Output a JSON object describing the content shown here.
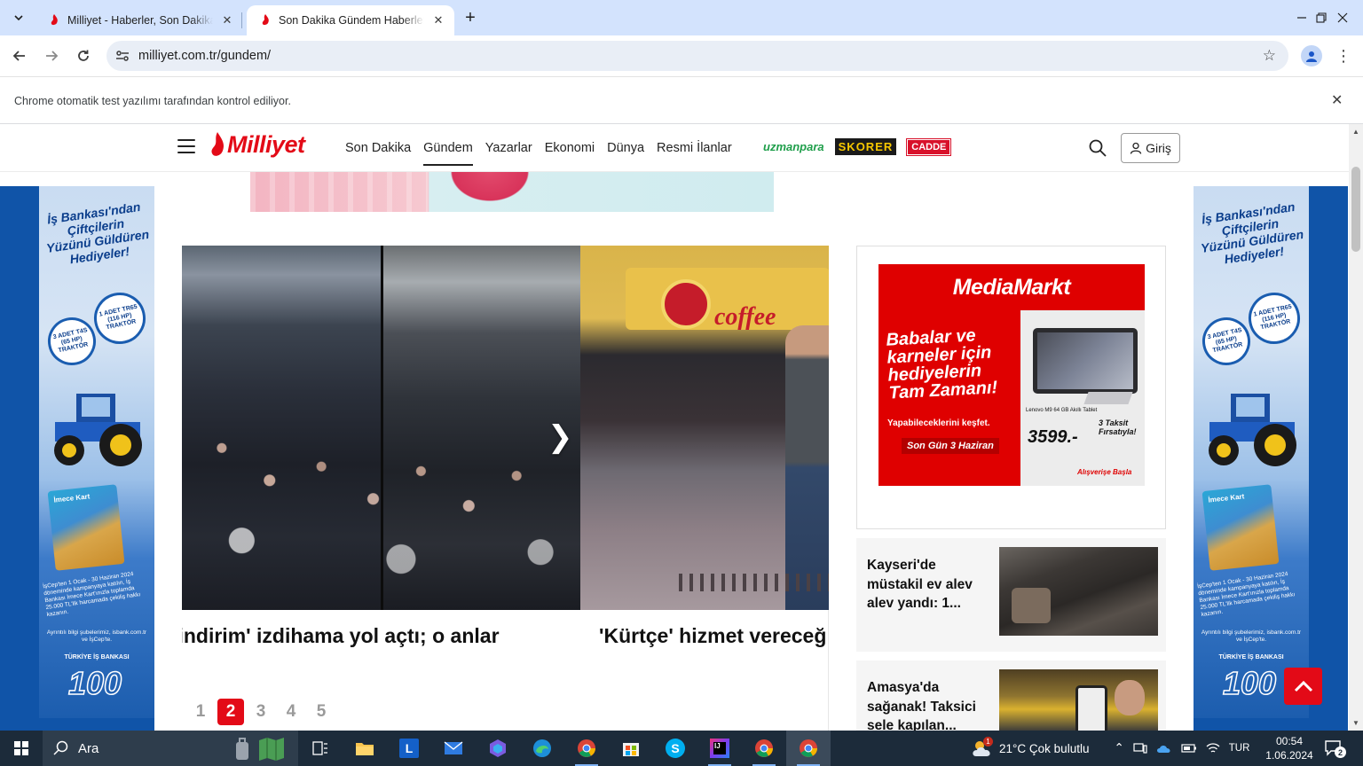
{
  "browser": {
    "tabs": [
      {
        "title": "Milliyet - Haberler, Son Dakika Haberleri",
        "active": false
      },
      {
        "title": "Son Dakika Gündem Haberleri",
        "active": true
      }
    ],
    "url": "milliyet.com.tr/gundem/",
    "infobar_message": "Chrome otomatik test yazılımı tarafından kontrol ediliyor."
  },
  "site": {
    "logo_text": "Milliyet",
    "nav": [
      {
        "label": "Son Dakika",
        "active": false
      },
      {
        "label": "Gündem",
        "active": true
      },
      {
        "label": "Yazarlar",
        "active": false
      },
      {
        "label": "Ekonomi",
        "active": false
      },
      {
        "label": "Dünya",
        "active": false
      },
      {
        "label": "Resmi İlanlar",
        "active": false
      }
    ],
    "brands": [
      "uzmanpara",
      "SKORER",
      "CADDE"
    ],
    "login_label": "Giriş"
  },
  "side_ad": {
    "title": "İş Bankası'ndan Çiftçilerin Yüzünü Güldüren Hediyeler!",
    "badge_1": "1 ADET TR65 (116 HP) TRAKTÖR",
    "badge_2": "3 ADET T4S (65 HP) TRAKTÖR",
    "card_label": "İmece Kart",
    "small_text": "İşCep'ten 1 Ocak - 30 Haziran 2024 döneminde kampanyaya katılın, İş Bankası İmece Kart'ınızla toplamda 25.000 TL'lik harcamada çekiliş hakkı kazanın.",
    "footer": "Ayrıntılı bilgi şubelerimiz, isbank.com.tr ve İşCep'te.",
    "brand": "TÜRKİYE İŞ BANKASI",
    "anniversary": "100"
  },
  "slider": {
    "captions": [
      "'indirim' izdihama yol açtı; o anlar",
      "'Kürtçe' hizmet vereceğ"
    ],
    "cafe_sign": "coffee",
    "pages": [
      {
        "label": "1",
        "active": false
      },
      {
        "label": "2",
        "active": true
      },
      {
        "label": "3",
        "active": false
      },
      {
        "label": "4",
        "active": false
      },
      {
        "label": "5",
        "active": false
      }
    ]
  },
  "mediamarkt_ad": {
    "brand": "MediaMarkt",
    "headline": "Babalar ve karneler için hediyelerin Tam Zamanı!",
    "sub": "Yapabileceklerini keşfet.",
    "badge": "Son Gün 3 Haziran",
    "product": "Lenovo M9 64 GB Akıllı Tablet",
    "price": "3599.-",
    "installments": "3 Taksit Fırsatıyla!",
    "cta": "Alışverişe Başla"
  },
  "news": [
    {
      "title": "Kayseri'de müstakil ev alev alev yandı: 1..."
    },
    {
      "title": "Amasya'da sağanak! Taksici sele kapılan..."
    }
  ],
  "taskbar": {
    "search_placeholder": "Ara",
    "weather": "21°C  Çok bulutlu",
    "weather_badge": "1",
    "language": "TUR",
    "time": "00:54",
    "date": "1.06.2024",
    "notifications": "2"
  }
}
